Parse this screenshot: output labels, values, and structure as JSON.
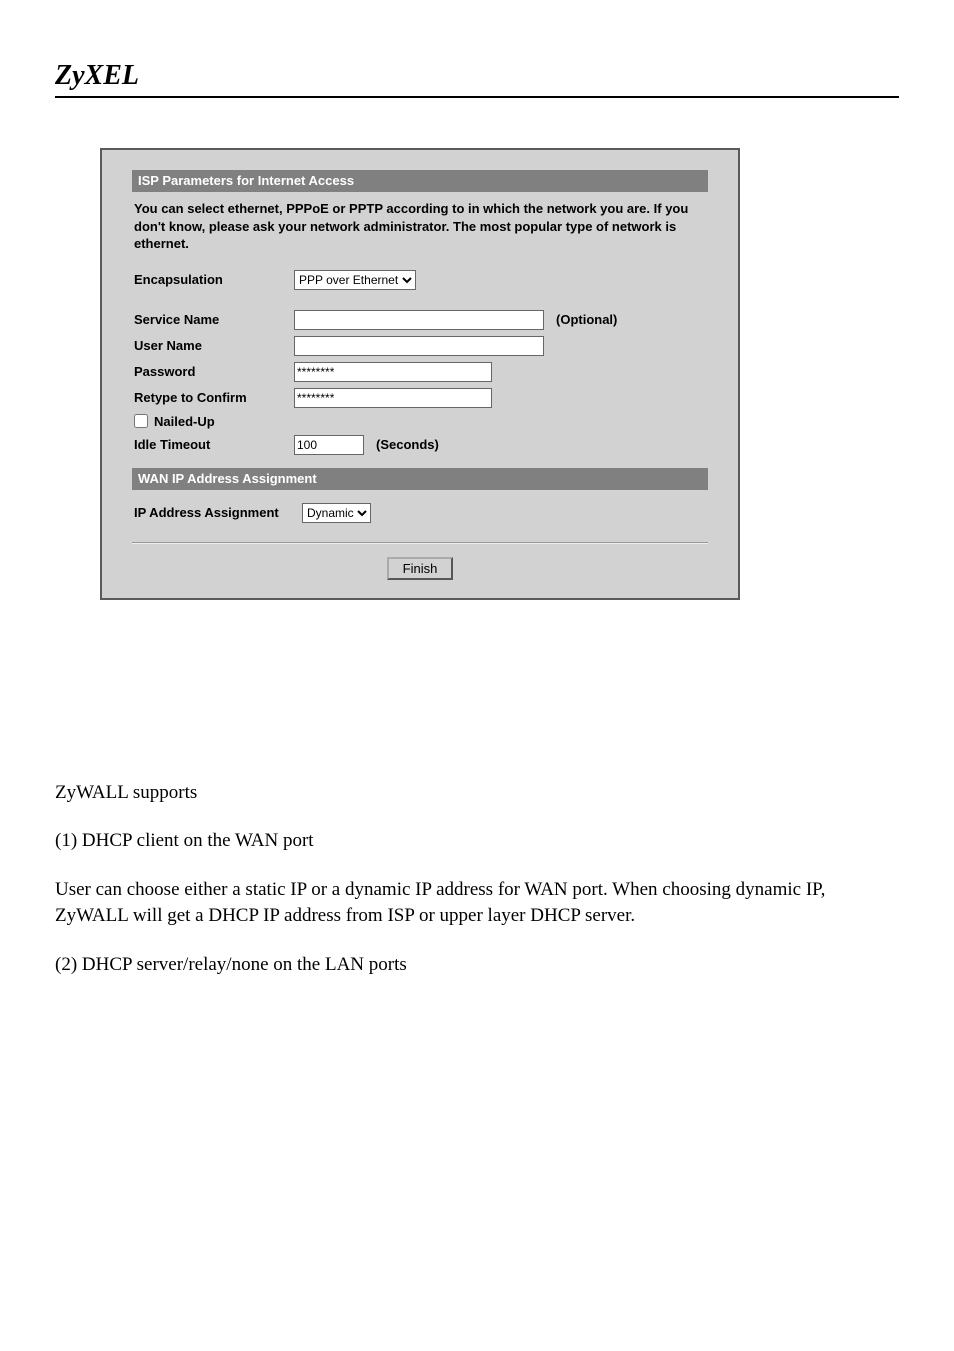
{
  "brand": "ZyXEL",
  "panel": {
    "section1_title": "ISP Parameters for Internet Access",
    "description": "You can select ethernet, PPPoE or PPTP according to in which the network you are. If you don't know, please ask your network administrator. The most popular type of network is ethernet.",
    "labels": {
      "encapsulation": "Encapsulation",
      "service_name": "Service Name",
      "user_name": "User Name",
      "password": "Password",
      "retype": "Retype to Confirm",
      "nailed_up": "Nailed-Up",
      "idle_timeout": "Idle Timeout",
      "ip_assignment": "IP Address Assignment"
    },
    "values": {
      "encapsulation": "PPP over Ethernet",
      "service_name": "",
      "user_name": "",
      "password": "********",
      "retype": "********",
      "nailed_up_checked": false,
      "idle_timeout": "100",
      "ip_assignment": "Dynamic"
    },
    "suffixes": {
      "optional": "(Optional)",
      "seconds": "(Seconds)"
    },
    "section2_title": "WAN IP Address Assignment",
    "finish_button": "Finish"
  },
  "doc": {
    "supports_intro": "ZyWALL supports",
    "item1_num": "(1) DHCP client on the WAN port",
    "item1_body": "User can choose either a static IP or a dynamic IP address for WAN port. When choosing dynamic IP, ZyWALL will get a DHCP IP address from ISP or upper layer DHCP server.",
    "item2_num": "(2) DHCP server/relay/none on the LAN ports"
  }
}
